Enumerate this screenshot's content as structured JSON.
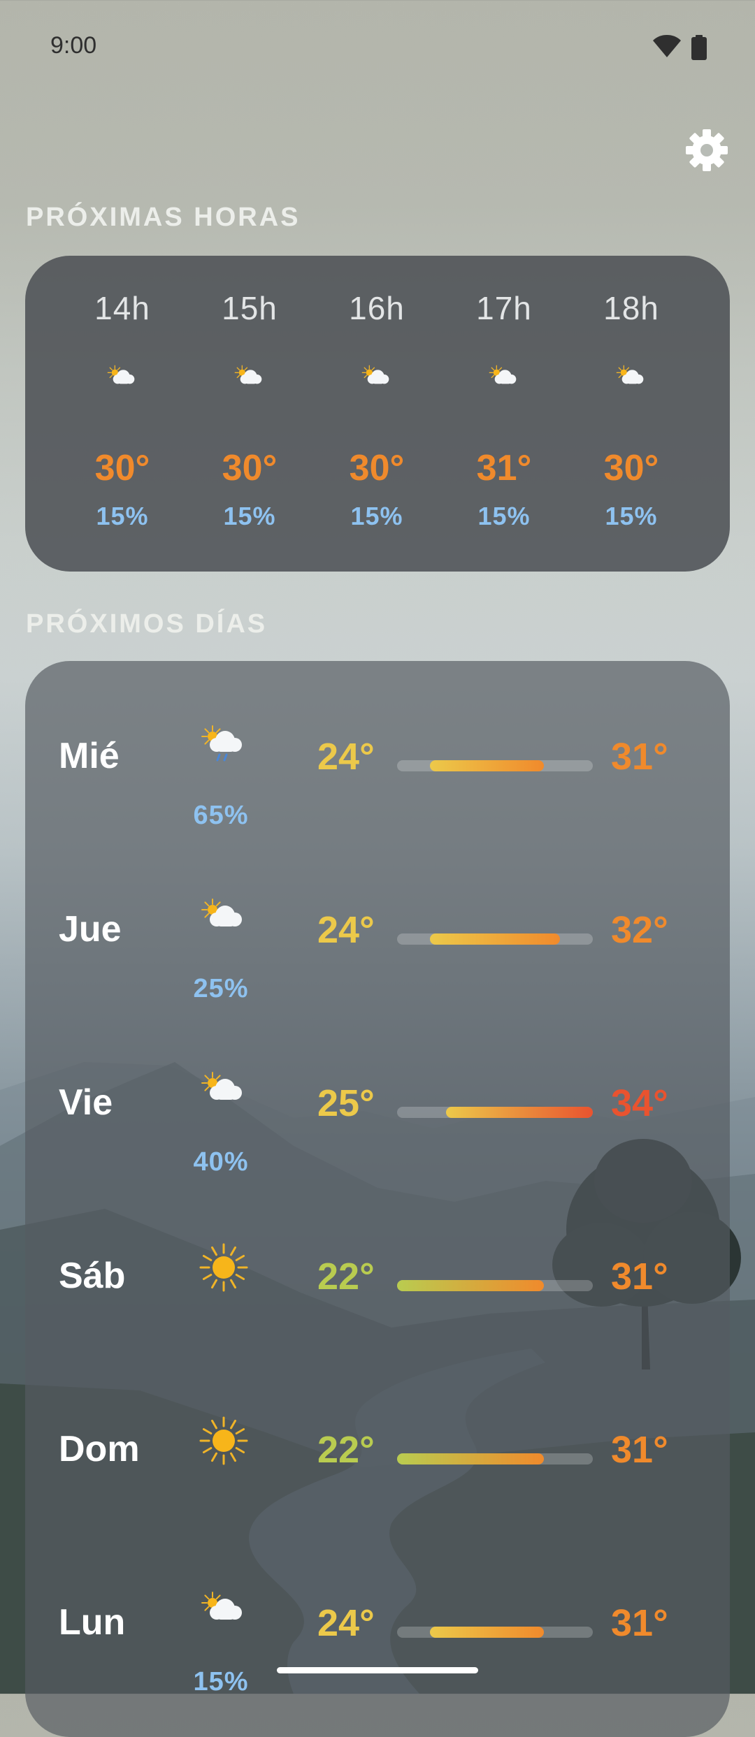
{
  "status_bar": {
    "time": "9:00"
  },
  "colors": {
    "accent_orange": "#f08a2c",
    "hot_red": "#e9532f",
    "warm_yellow": "#ecc94a",
    "mild_green": "#b9cc50",
    "precip_blue": "#8ec2f0"
  },
  "settings": {
    "icon": "gear-icon"
  },
  "hourly": {
    "title": "PRÓXIMAS HORAS",
    "items": [
      {
        "hour": "14h",
        "icon": "partly-cloudy-icon",
        "temp": "30°",
        "pop": "15%"
      },
      {
        "hour": "15h",
        "icon": "partly-cloudy-icon",
        "temp": "30°",
        "pop": "15%"
      },
      {
        "hour": "16h",
        "icon": "partly-cloudy-icon",
        "temp": "30°",
        "pop": "15%"
      },
      {
        "hour": "17h",
        "icon": "partly-cloudy-icon",
        "temp": "31°",
        "pop": "15%"
      },
      {
        "hour": "18h",
        "icon": "partly-cloudy-icon",
        "temp": "30°",
        "pop": "15%"
      }
    ]
  },
  "daily": {
    "title": "PRÓXIMOS DÍAS",
    "range": [
      22,
      34
    ],
    "items": [
      {
        "day": "Mié",
        "icon": "cloud-rain-sun-icon",
        "pop": "65%",
        "min": "24°",
        "max": "31°",
        "min_value": 24,
        "max_value": 31,
        "min_color": "#ecc94a",
        "max_color": "#f08a2c"
      },
      {
        "day": "Jue",
        "icon": "partly-cloudy-icon",
        "pop": "25%",
        "min": "24°",
        "max": "32°",
        "min_value": 24,
        "max_value": 32,
        "min_color": "#ecc94a",
        "max_color": "#f08a2c"
      },
      {
        "day": "Vie",
        "icon": "partly-cloudy-icon",
        "pop": "40%",
        "min": "25°",
        "max": "34°",
        "min_value": 25,
        "max_value": 34,
        "min_color": "#ecc94a",
        "max_color": "#e9532f"
      },
      {
        "day": "Sáb",
        "icon": "sun-icon",
        "pop": "",
        "min": "22°",
        "max": "31°",
        "min_value": 22,
        "max_value": 31,
        "min_color": "#b9cc50",
        "max_color": "#f08a2c"
      },
      {
        "day": "Dom",
        "icon": "sun-icon",
        "pop": "",
        "min": "22°",
        "max": "31°",
        "min_value": 22,
        "max_value": 31,
        "min_color": "#b9cc50",
        "max_color": "#f08a2c"
      },
      {
        "day": "Lun",
        "icon": "partly-cloudy-icon",
        "pop": "15%",
        "min": "24°",
        "max": "31°",
        "min_value": 24,
        "max_value": 31,
        "min_color": "#ecc94a",
        "max_color": "#f08a2c"
      }
    ]
  }
}
